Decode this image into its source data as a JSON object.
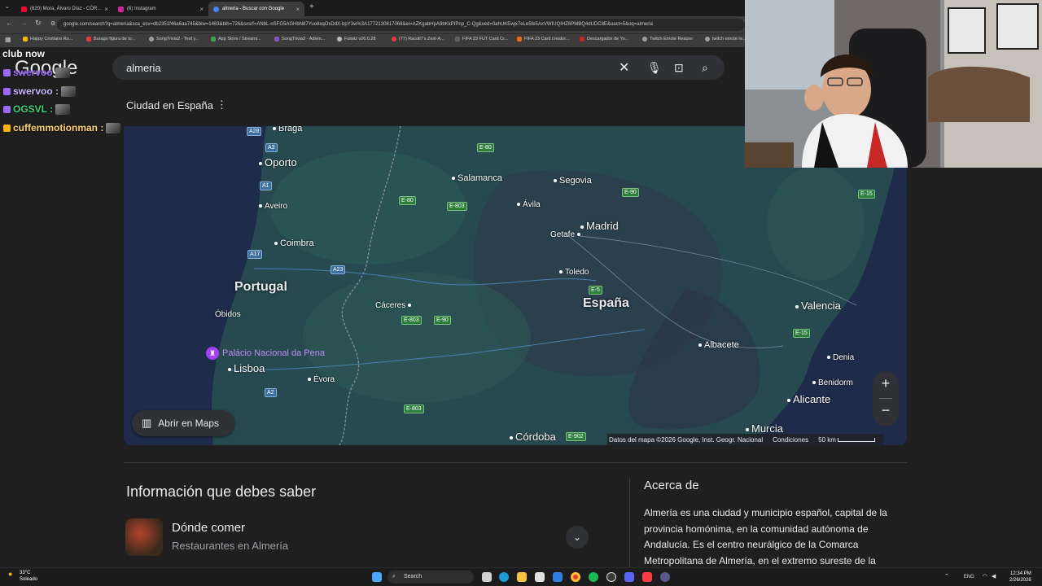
{
  "browser": {
    "tabs": [
      {
        "label": "(620) Mora, Álvaro Díaz - CÓR...",
        "color": "#ff0033"
      },
      {
        "label": "(6) Instagram",
        "color": "#d6249f"
      },
      {
        "label": "almeria - Buscar con Google",
        "color": "#4285f4"
      }
    ],
    "url": "google.com/search?q=almeria&sca_esv=db2351f46a6aa745&biw=1463&bih=726&sxsrf=ANbL-nSFG5AGHbN87Yuo8xqOxDdX-bpY3w%3A1772130817068&ei=AZKgabHpA9bKkPIPnp_C-Qg&ved=0ahUKEwjx7eLe5fe5AxVWIUQIHZ6PMBQ4dUDC8E&uact=5&oq=almeria",
    "bookmarks": [
      "Happy Cristiano Ro...",
      "Burago figura de to...",
      "SongTrivia2 - Test y...",
      "App Store / Streami...",
      "SongTrivia2 - Adivin...",
      "Futwiz v26.0.28",
      "(77) Racoll7's Zest-A...",
      "FIFA 23 FUT Card Cr...",
      "FIFA 23 Card creator...",
      "Descargador de Yo...",
      "Twitch Emote Resizer",
      "twitch emote re..."
    ]
  },
  "search": {
    "logo": "Google",
    "query": "almeria",
    "subtitle": "Ciudad en España"
  },
  "chat": {
    "header": "club now",
    "messages": [
      {
        "user": "swervoo",
        "color": "#9b6bff"
      },
      {
        "user": "swervoo :",
        "color": "#c9b6ff"
      },
      {
        "user": "OGSVL :",
        "color": "#3fd07a"
      },
      {
        "user": "cuffemmotionman :",
        "color": "#ffd36b"
      }
    ]
  },
  "map": {
    "countries": [
      "Portugal",
      "España"
    ],
    "cities": [
      "Braga",
      "Oporto",
      "Aveiro",
      "Coimbra",
      "Óbidos",
      "Lisboa",
      "Évora",
      "Salamanca",
      "Segovia",
      "Ávila",
      "Madrid",
      "Getafe",
      "Toledo",
      "Cáceres",
      "Valencia",
      "Albacete",
      "Denia",
      "Benidorm",
      "Alicante",
      "Murcia",
      "Córdoba"
    ],
    "roads": [
      "A28",
      "A3",
      "A1",
      "A17",
      "A23",
      "A2",
      "E-80",
      "E-803",
      "E-90",
      "E-5",
      "E-15",
      "E-902"
    ],
    "poi": "Palácio Nacional da Pena",
    "open_maps": "Abrir en Maps",
    "attribution": "Datos del mapa ©2026 Google, Inst. Geogr. Nacional",
    "terms": "Condiciones",
    "scale": "50 km",
    "zoom_in": "+",
    "zoom_out": "−"
  },
  "info": {
    "title": "Información que debes saber",
    "eat_title": "Dónde comer",
    "eat_sub": "Restaurantes en Almería",
    "about_title": "Acerca de",
    "about_body": "Almería es una ciudad y municipio español, capital de la provincia homónima, en la comunidad autónoma de Andalucía. Es el centro neurálgico de la Comarca Metropolitana de Almería, en el extremo sureste de la"
  },
  "taskbar": {
    "temp": "33°C",
    "weather": "Soleado",
    "search": "Search",
    "lang": "ENG",
    "time": "12:34 PM",
    "date": "2/26/2026"
  },
  "colors": {
    "map_land": "#264a50",
    "map_dark": "#2b2f45",
    "accent_purple": "#a142f4"
  }
}
